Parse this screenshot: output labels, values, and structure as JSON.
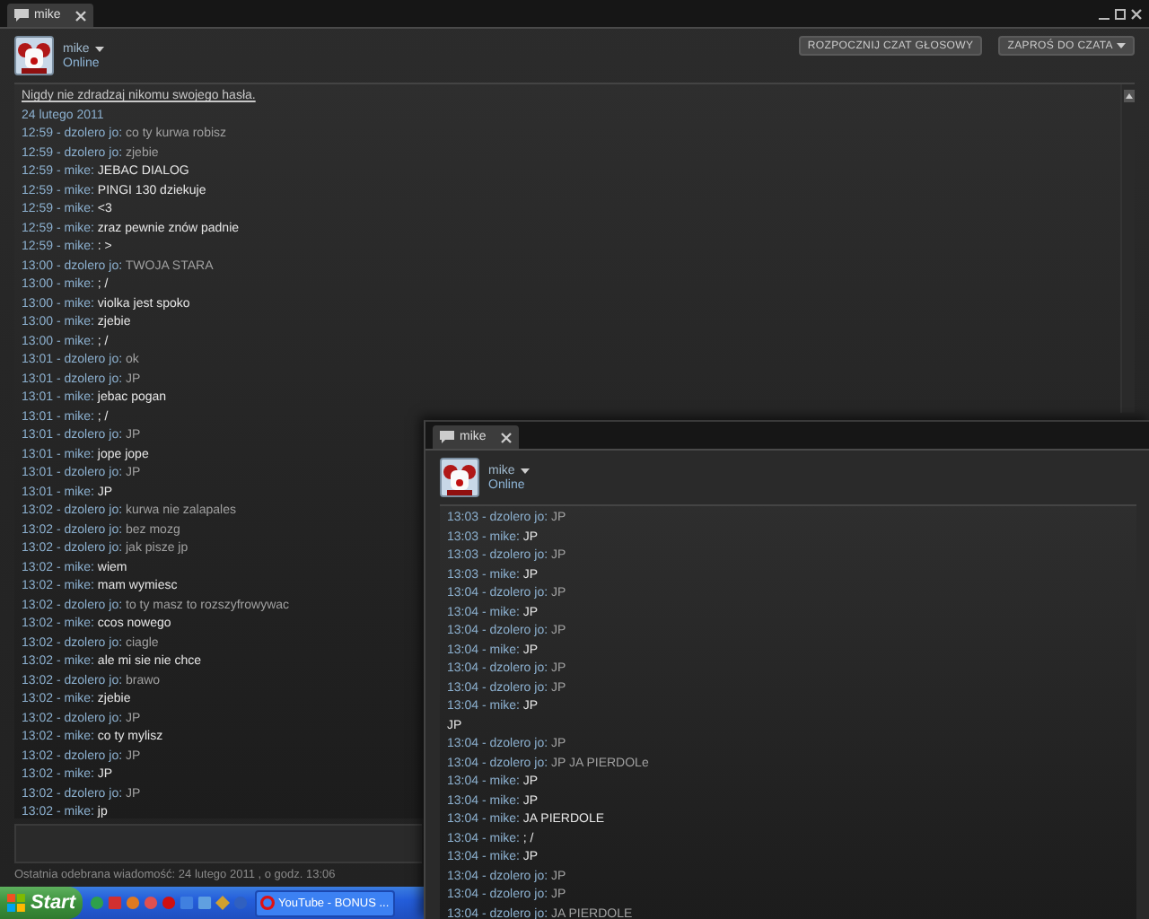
{
  "main_window": {
    "tab": "mike",
    "contact": {
      "name": "mike",
      "status": "Online"
    },
    "buttons": [
      {
        "label": "ROZPOCZNIJ CZAT GŁOSOWY",
        "dropdown": false
      },
      {
        "label": "ZAPROŚ DO CZATA",
        "dropdown": true
      }
    ],
    "warning": "Nigdy nie zdradzaj nikomu swojego hasła.",
    "date": "24 lutego 2011",
    "messages": [
      {
        "kind": "friend",
        "meta": "12:59 - dzolero jo:",
        "text": "co ty kurwa robisz"
      },
      {
        "kind": "friend",
        "meta": "12:59 - dzolero jo:",
        "text": "zjebie"
      },
      {
        "kind": "self",
        "meta": "12:59 - mike:",
        "text": "JEBAC DIALOG"
      },
      {
        "kind": "self",
        "meta": "12:59 - mike:",
        "text": "PINGI 130 dziekuje"
      },
      {
        "kind": "self",
        "meta": "12:59 - mike:",
        "text": "<3"
      },
      {
        "kind": "self",
        "meta": "12:59 - mike:",
        "text": "zraz pewnie znów padnie"
      },
      {
        "kind": "self",
        "meta": "12:59 - mike:",
        "text": ": >"
      },
      {
        "kind": "friend",
        "meta": "13:00 - dzolero jo:",
        "text": "TWOJA STARA"
      },
      {
        "kind": "self",
        "meta": "13:00 - mike:",
        "text": "; /"
      },
      {
        "kind": "self",
        "meta": "13:00 - mike:",
        "text": "violka jest spoko"
      },
      {
        "kind": "self",
        "meta": "13:00 - mike:",
        "text": "zjebie"
      },
      {
        "kind": "self",
        "meta": "13:00 - mike:",
        "text": "; /"
      },
      {
        "kind": "friend",
        "meta": "13:01 - dzolero jo:",
        "text": "ok"
      },
      {
        "kind": "friend",
        "meta": "13:01 - dzolero jo:",
        "text": "JP"
      },
      {
        "kind": "self",
        "meta": "13:01 - mike:",
        "text": "jebac pogan"
      },
      {
        "kind": "self",
        "meta": "13:01 - mike:",
        "text": "; /"
      },
      {
        "kind": "friend",
        "meta": "13:01 - dzolero jo:",
        "text": "JP"
      },
      {
        "kind": "self",
        "meta": "13:01 - mike:",
        "text": "jope jope"
      },
      {
        "kind": "friend",
        "meta": "13:01 - dzolero jo:",
        "text": "JP"
      },
      {
        "kind": "self",
        "meta": "13:01 - mike:",
        "text": "JP"
      },
      {
        "kind": "friend",
        "meta": "13:02 - dzolero jo:",
        "text": "kurwa nie zalapales"
      },
      {
        "kind": "friend",
        "meta": "13:02 - dzolero jo:",
        "text": "bez mozg"
      },
      {
        "kind": "friend",
        "meta": "13:02 - dzolero jo:",
        "text": "jak pisze jp"
      },
      {
        "kind": "self",
        "meta": "13:02 - mike:",
        "text": "wiem"
      },
      {
        "kind": "self",
        "meta": "13:02 - mike:",
        "text": "mam wymiesc"
      },
      {
        "kind": "friend",
        "meta": "13:02 - dzolero jo:",
        "text": "to ty masz to rozszyfrowywac"
      },
      {
        "kind": "self",
        "meta": "13:02 - mike:",
        "text": "ccos nowego"
      },
      {
        "kind": "friend",
        "meta": "13:02 - dzolero jo:",
        "text": "ciagle"
      },
      {
        "kind": "self",
        "meta": "13:02 - mike:",
        "text": "ale mi sie nie chce"
      },
      {
        "kind": "friend",
        "meta": "13:02 - dzolero jo:",
        "text": "brawo"
      },
      {
        "kind": "self",
        "meta": "13:02 - mike:",
        "text": "zjebie"
      },
      {
        "kind": "friend",
        "meta": "13:02 - dzolero jo:",
        "text": "JP"
      },
      {
        "kind": "self",
        "meta": "13:02 - mike:",
        "text": "co ty mylisz"
      },
      {
        "kind": "friend",
        "meta": "13:02 - dzolero jo:",
        "text": "JP"
      },
      {
        "kind": "self",
        "meta": "13:02 - mike:",
        "text": "JP"
      },
      {
        "kind": "friend",
        "meta": "13:02 - dzolero jo:",
        "text": "JP"
      },
      {
        "kind": "self",
        "meta": "13:02 - mike:",
        "text": "jp"
      }
    ],
    "status_bar": "Ostatnia odebrana wiadomość: 24 lutego 2011 , o godz. 13:06"
  },
  "second_window": {
    "tab": "mike",
    "contact": {
      "name": "mike",
      "status": "Online"
    },
    "messages": [
      {
        "kind": "friend",
        "meta": "13:03 - dzolero jo:",
        "text": "JP"
      },
      {
        "kind": "self",
        "meta": "13:03 - mike:",
        "text": "JP"
      },
      {
        "kind": "friend",
        "meta": "13:03 - dzolero jo:",
        "text": "JP"
      },
      {
        "kind": "self",
        "meta": "13:03 - mike:",
        "text": "JP"
      },
      {
        "kind": "friend",
        "meta": "13:04 - dzolero jo:",
        "text": "JP"
      },
      {
        "kind": "self",
        "meta": "13:04 - mike:",
        "text": "JP"
      },
      {
        "kind": "friend",
        "meta": "13:04 - dzolero jo:",
        "text": "JP"
      },
      {
        "kind": "self",
        "meta": "13:04 - mike:",
        "text": "JP"
      },
      {
        "kind": "friend",
        "meta": "13:04 - dzolero jo:",
        "text": "JP"
      },
      {
        "kind": "friend",
        "meta": "13:04 - dzolero jo:",
        "text": "JP"
      },
      {
        "kind": "self",
        "meta": "13:04 - mike:",
        "text": "JP"
      },
      {
        "kind": "continuation",
        "text": "JP"
      },
      {
        "kind": "friend",
        "meta": "13:04 - dzolero jo:",
        "text": "JP"
      },
      {
        "kind": "friend",
        "meta": "13:04 - dzolero jo:",
        "text": "JP JA PIERDOLe"
      },
      {
        "kind": "self",
        "meta": "13:04 - mike:",
        "text": "JP"
      },
      {
        "kind": "self",
        "meta": "13:04 - mike:",
        "text": "JP"
      },
      {
        "kind": "self",
        "meta": "13:04 - mike:",
        "text": "JA PIERDOLE"
      },
      {
        "kind": "self",
        "meta": "13:04 - mike:",
        "text": "; /"
      },
      {
        "kind": "self",
        "meta": "13:04 - mike:",
        "text": "JP"
      },
      {
        "kind": "friend",
        "meta": "13:04 - dzolero jo:",
        "text": "JP"
      },
      {
        "kind": "friend",
        "meta": "13:04 - dzolero jo:",
        "text": "JP"
      },
      {
        "kind": "friend",
        "meta": "13:04 - dzolero jo:",
        "text": "JA PIERDOLE"
      }
    ]
  },
  "taskbar": {
    "start": "Start",
    "tasks": [
      {
        "label": "YouTube - BONUS ..."
      }
    ]
  }
}
